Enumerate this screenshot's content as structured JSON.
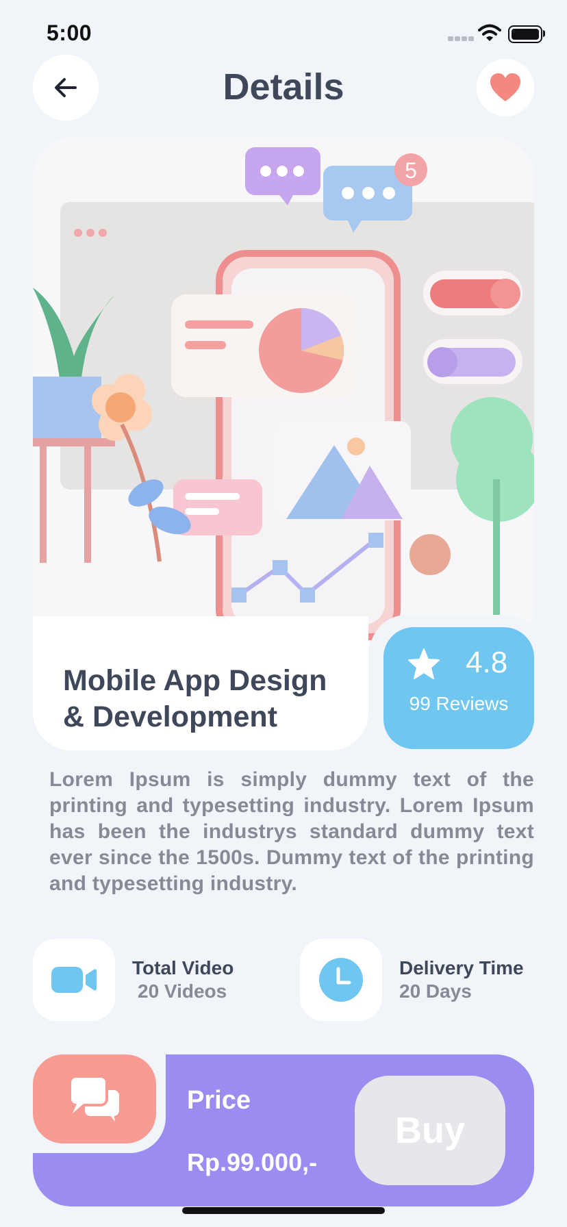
{
  "status_bar": {
    "time": "5:00"
  },
  "header": {
    "title": "Details"
  },
  "course": {
    "title_line1": "Mobile App Design",
    "title_line2": "& Development",
    "rating": "4.8",
    "reviews": "99 Reviews",
    "description": "Lorem Ipsum is simply dummy text of the printing and typesetting industry. Lorem Ipsum has been the industrys standard dummy text ever since the 1500s. Dummy text of the printing and typesetting industry."
  },
  "hero_badge": "5",
  "info": {
    "video_label": "Total Video",
    "video_value": "20 Videos",
    "delivery_label": "Delivery Time",
    "delivery_value": "20 Days"
  },
  "purchase": {
    "price_label": "Price",
    "price_value": "Rp.99.000,-",
    "buy_label": "Buy"
  },
  "colors": {
    "background": "#f1f5f9",
    "rating_bg": "#6ec6f1",
    "price_bar": "#9b8cf2",
    "chat_button": "#f79b93",
    "heart": "#f4877f",
    "title_text": "#3f475a"
  },
  "icons": {
    "back": "arrow-left-icon",
    "favorite": "heart-icon",
    "rating": "star-icon",
    "video": "video-camera-icon",
    "delivery": "clock-icon",
    "chat": "chat-bubbles-icon"
  }
}
